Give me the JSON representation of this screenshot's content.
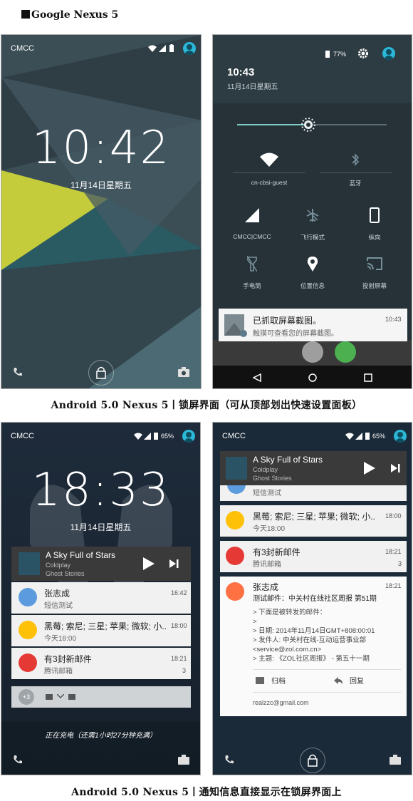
{
  "heading": "Google Nexus 5",
  "caption_top": "Android 5.0 Nexus 5丨锁屏界面（可从顶部划出快速设置面板）",
  "caption_bottom": "Android 5.0 Nexus 5丨通知信息直接显示在锁屏界面上",
  "colors": {
    "accent_teal": "#2bb8d8",
    "lollipop_bg_dark": "#263238",
    "lollipop_bg_mid": "#37474f",
    "lollipop_yellow": "#c0ca33",
    "qs_bg": "#263238",
    "night_bg": "#1b2a38",
    "yellow_icon": "#ffc107",
    "red_icon": "#e53935",
    "orange_icon": "#ff7043",
    "blue_icon": "#5c9bde"
  },
  "screen1": {
    "carrier": "CMCC",
    "time": "10:42",
    "date": "11月14日星期五",
    "icons": [
      "wifi-icon",
      "signal-icon",
      "battery-icon",
      "avatar",
      "phone-icon",
      "lock-icon",
      "camera-icon"
    ]
  },
  "screen2": {
    "battery": "77%",
    "time": "10:43",
    "date": "11月14日星期五",
    "brightness_level": 0.45,
    "tiles": [
      {
        "label": "cn-cbsi-guest",
        "icon": "wifi-icon"
      },
      {
        "label": "蓝牙",
        "icon": "bluetooth-icon"
      },
      {
        "label": "CMCC|CMCC",
        "icon": "signal-icon"
      },
      {
        "label": "飞行模式",
        "icon": "airplane-icon"
      },
      {
        "label": "纵向",
        "icon": "rotation-icon"
      },
      {
        "label": "手电筒",
        "icon": "flashlight-icon"
      },
      {
        "label": "位置信息",
        "icon": "location-icon"
      },
      {
        "label": "投射屏幕",
        "icon": "cast-icon"
      }
    ],
    "notification": {
      "title": "已抓取屏幕截图。",
      "text": "触摸可查看您的屏幕截图。",
      "time": "10:43"
    }
  },
  "screen3": {
    "carrier": "CMCC",
    "battery": "65%",
    "time": "18:33",
    "date": "11月14日星期五",
    "music": {
      "title": "A Sky Full of Stars",
      "artist": "Coldplay",
      "album": "Ghost Stories"
    },
    "notifications": [
      {
        "title": "张志成",
        "text": "短信测试",
        "time": "16:42",
        "count": ""
      },
      {
        "title": "黑莓; 索尼; 三星; 苹果; 微软; 小..",
        "text": "今天18:00",
        "time": "18:00",
        "count": ""
      },
      {
        "title": "有3封新邮件",
        "text": "腾讯邮箱",
        "time": "18:21",
        "count": "3"
      }
    ],
    "overflow": "+3",
    "charging": "正在充电（还需1小时27分钟充满）"
  },
  "screen4": {
    "carrier": "CMCC",
    "battery": "65%",
    "music": {
      "title": "A Sky Full of Stars",
      "artist": "Coldplay",
      "album": "Ghost Stories"
    },
    "peek_text": "短信测试",
    "notifications": [
      {
        "title": "黑莓; 索尼; 三星; 苹果; 微软; 小..",
        "text": "今天18:00",
        "time": "18:00",
        "count": ""
      },
      {
        "title": "有3封新邮件",
        "text": "腾讯邮箱",
        "time": "18:21",
        "count": "3"
      }
    ],
    "email": {
      "sender": "张志成",
      "subject": "测试邮件：中关村在线社区周报 第51期",
      "time": "18:21",
      "body": [
        "> 下面是被转发的邮件：",
        ">",
        "> 日期: 2014年11月14日GMT+808:00:01",
        "> 发件人: 中关村在线-互动运营事业部",
        "<service@zol.com.cn>",
        "> 主题: 《ZOL社区周报》 - 第五十一期"
      ],
      "archive_label": "归档",
      "reply_label": "回复",
      "account": "realzzc@gmail.com"
    }
  }
}
